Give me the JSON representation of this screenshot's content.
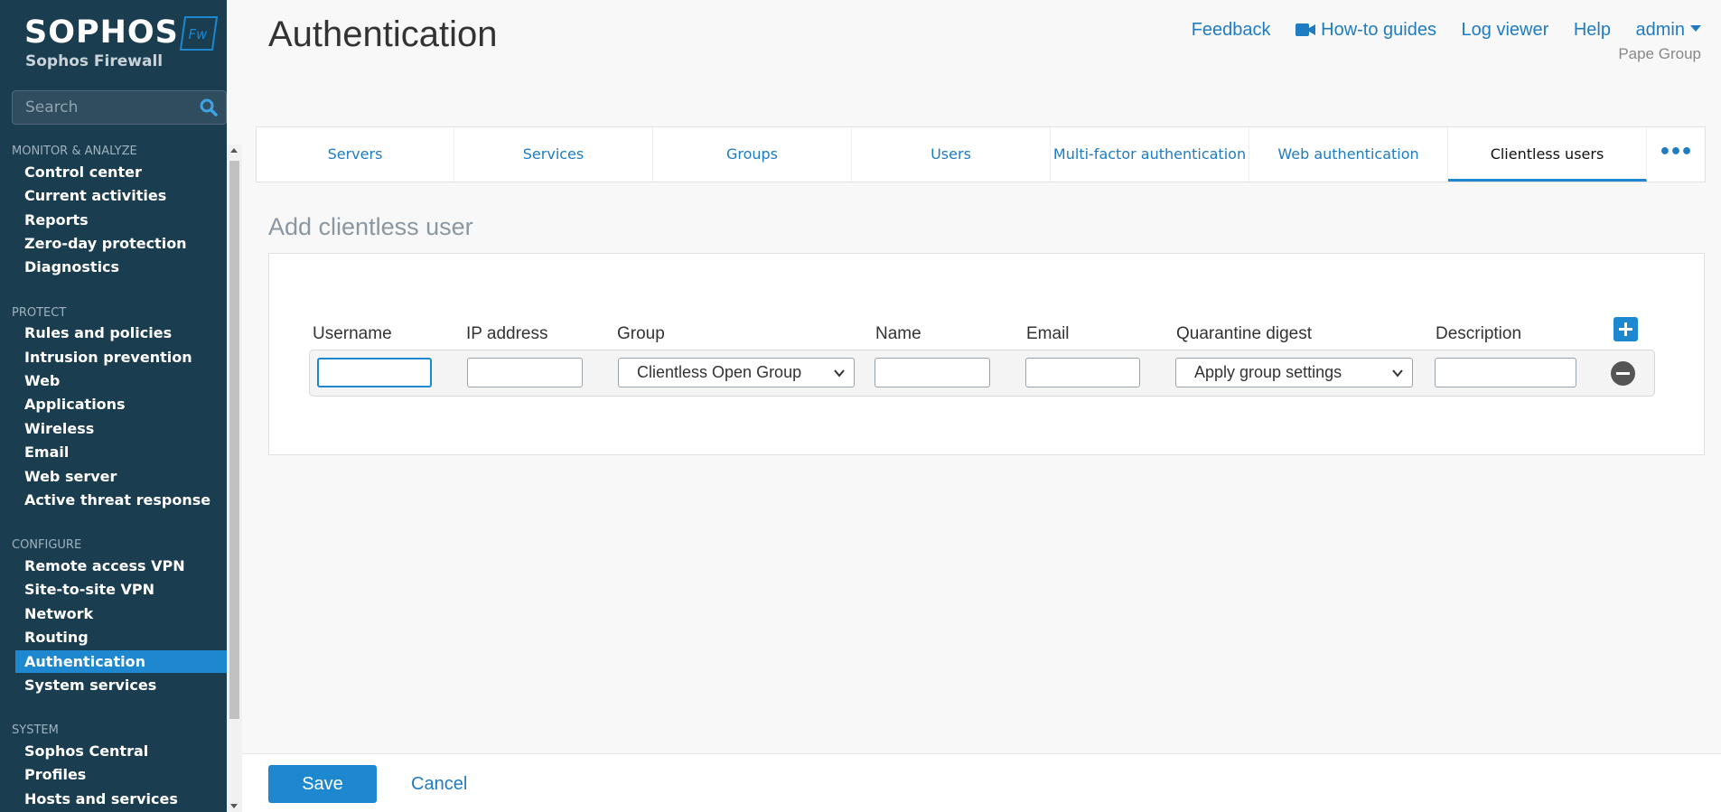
{
  "brand": {
    "name": "SOPHOS",
    "badge": "Fw",
    "product": "Sophos Firewall"
  },
  "search": {
    "placeholder": "Search"
  },
  "sidebar": {
    "sections": [
      {
        "title": "MONITOR & ANALYZE",
        "items": [
          "Control center",
          "Current activities",
          "Reports",
          "Zero-day protection",
          "Diagnostics"
        ]
      },
      {
        "title": "PROTECT",
        "items": [
          "Rules and policies",
          "Intrusion prevention",
          "Web",
          "Applications",
          "Wireless",
          "Email",
          "Web server",
          "Active threat response"
        ]
      },
      {
        "title": "CONFIGURE",
        "items": [
          "Remote access VPN",
          "Site-to-site VPN",
          "Network",
          "Routing",
          "Authentication",
          "System services"
        ]
      },
      {
        "title": "SYSTEM",
        "items": [
          "Sophos Central",
          "Profiles",
          "Hosts and services"
        ]
      }
    ],
    "active_item": "Authentication"
  },
  "header": {
    "title": "Authentication",
    "links": {
      "feedback": "Feedback",
      "howto": "How-to guides",
      "logviewer": "Log viewer",
      "help": "Help",
      "user": "admin"
    },
    "org": "Pape Group"
  },
  "tabs": {
    "items": [
      "Servers",
      "Services",
      "Groups",
      "Users",
      "Multi-factor authentication",
      "Web authentication",
      "Clientless users"
    ],
    "active": "Clientless users"
  },
  "form": {
    "title": "Add clientless user",
    "columns": {
      "username": "Username",
      "ip": "IP address",
      "group": "Group",
      "name": "Name",
      "email": "Email",
      "quarantine": "Quarantine digest",
      "description": "Description"
    },
    "row": {
      "username": "",
      "ip": "",
      "group": "Clientless Open Group",
      "name": "",
      "email": "",
      "quarantine": "Apply group settings",
      "description": ""
    }
  },
  "footer": {
    "save": "Save",
    "cancel": "Cancel"
  },
  "colors": {
    "sidebar_bg": "#1b3d50",
    "accent": "#1d87cf",
    "link": "#1f7cc1"
  }
}
